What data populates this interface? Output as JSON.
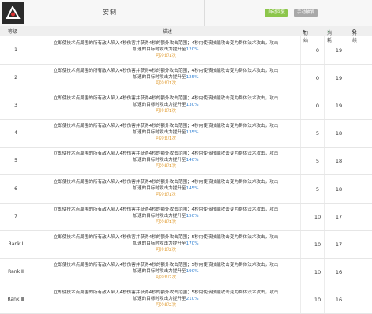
{
  "header": {
    "skill_name": "安制",
    "badge_recovery": "自动回复",
    "badge_trigger": "手动触发",
    "icon": "skill-icon"
  },
  "columns": {
    "level": "等级",
    "desc": "描述",
    "initial": "初始",
    "cost": "消耗",
    "duration": "持续"
  },
  "rows": [
    {
      "level": "1",
      "line1": "立即使技术点周围的所有敌人陷入4秒伤害并获得4秒的额外攻击范围；4秒内使该技能攻击变为群体法术攻击，攻击",
      "line2": "加速的目标时攻击力提升至",
      "value": "120%",
      "req": "可冷却1次",
      "initial": "0",
      "cost": "19",
      "duration": ""
    },
    {
      "level": "2",
      "line1": "立即使技术点周围的所有敌人陷入4秒伤害并获得4秒的额外攻击范围；4秒内使该技能攻击变为群体法术攻击，攻击",
      "line2": "加速的目标时攻击力提升至",
      "value": "125%",
      "req": "可冷却1次",
      "initial": "0",
      "cost": "19",
      "duration": ""
    },
    {
      "level": "3",
      "line1": "立即使技术点周围的所有敌人陷入4秒伤害并获得4秒的额外攻击范围；4秒内使该技能攻击变为群体法术攻击，攻击",
      "line2": "加速的目标时攻击力提升至",
      "value": "130%",
      "req": "可冷却1次",
      "initial": "0",
      "cost": "19",
      "duration": ""
    },
    {
      "level": "4",
      "line1": "立即使技术点周围的所有敌人陷入4秒伤害并获得4秒的额外攻击范围；4秒内使该技能攻击变为群体法术攻击，攻击",
      "line2": "加速的目标时攻击力提升至",
      "value": "135%",
      "req": "可冷却1次",
      "initial": "5",
      "cost": "18",
      "duration": ""
    },
    {
      "level": "5",
      "line1": "立即使技术点周围的所有敌人陷入4秒伤害并获得4秒的额外攻击范围；4秒内使该技能攻击变为群体法术攻击，攻击",
      "line2": "加速的目标时攻击力提升至",
      "value": "140%",
      "req": "可冷却1次",
      "initial": "5",
      "cost": "18",
      "duration": ""
    },
    {
      "level": "6",
      "line1": "立即使技术点周围的所有敌人陷入4秒伤害并获得4秒的额外攻击范围；4秒内使该技能攻击变为群体法术攻击，攻击",
      "line2": "加速的目标时攻击力提升至",
      "value": "145%",
      "req": "可冷却1次",
      "initial": "5",
      "cost": "18",
      "duration": ""
    },
    {
      "level": "7",
      "line1": "立即使技术点周围的所有敌人陷入4秒伤害并获得4秒的额外攻击范围；4秒内使该技能攻击变为群体法术攻击，攻击",
      "line2": "加速的目标时攻击力提升至",
      "value": "150%",
      "req": "可冷却1次",
      "initial": "10",
      "cost": "17",
      "duration": ""
    },
    {
      "level": "Rank Ⅰ",
      "line1": "立即使技术点周围的所有敌人陷入4秒伤害并获得4秒的额外攻击范围；5秒内使该技能攻击变为群体法术攻击，攻击",
      "line2": "加速的目标时攻击力提升至",
      "value": "170%",
      "req": "可冷却2次",
      "initial": "10",
      "cost": "17",
      "duration": ""
    },
    {
      "level": "Rank Ⅱ",
      "line1": "立即使技术点周围的所有敌人陷入4秒伤害并获得4秒的额外攻击范围；5秒内使该技能攻击变为群体法术攻击，攻击",
      "line2": "加速的目标时攻击力提升至",
      "value": "190%",
      "req": "可冷却2次",
      "initial": "10",
      "cost": "16",
      "duration": ""
    },
    {
      "level": "Rank Ⅲ",
      "line1": "立即使技术点周围的所有敌人陷入4秒伤害并获得4秒的额外攻击范围；5秒内使该技能攻击变为群体法术攻击，攻击",
      "line2": "加速的目标时攻击力提升至",
      "value": "210%",
      "req": "可冷却2次",
      "initial": "10",
      "cost": "16",
      "duration": ""
    }
  ],
  "colors": {
    "highlight": "#2f7fd1",
    "requirement": "#e0992a",
    "badge_green": "#8cc64b",
    "badge_gray": "#a8a8a8"
  }
}
